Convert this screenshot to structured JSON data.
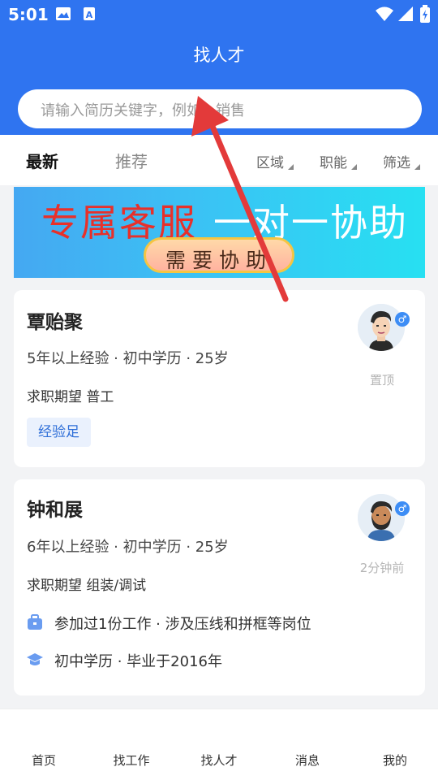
{
  "status": {
    "time": "5:01"
  },
  "header": {
    "title": "找人才"
  },
  "search": {
    "placeholder": "请输入简历关键字，例如：销售"
  },
  "tabs": [
    {
      "label": "最新"
    },
    {
      "label": "推荐"
    }
  ],
  "filters": [
    {
      "label": "区域"
    },
    {
      "label": "职能"
    },
    {
      "label": "筛选"
    }
  ],
  "banner": {
    "red_text": "专属客服",
    "white_text": "一对一协助",
    "button": "需要协助"
  },
  "candidates": [
    {
      "name": "覃贻聚",
      "meta": "5年以上经验 · 初中学历 · 25岁",
      "expect": "求职期望 普工",
      "tag": "经验足",
      "status": "置顶",
      "gender_symbol": "♂"
    },
    {
      "name": "钟和展",
      "meta": "6年以上经验 · 初中学历 · 25岁",
      "expect": "求职期望 组装/调试",
      "status": "2分钟前",
      "gender_symbol": "♂",
      "work": "参加过1份工作 · 涉及压线和拼框等岗位",
      "edu": "初中学历 · 毕业于2016年"
    }
  ],
  "bottom_nav": [
    {
      "label": "首页"
    },
    {
      "label": "找工作"
    },
    {
      "label": "找人才"
    },
    {
      "label": "消息"
    },
    {
      "label": "我的"
    }
  ],
  "colors": {
    "primary": "#2f74f0",
    "accent": "#e8302a",
    "tag_bg": "#eaf1fd"
  }
}
